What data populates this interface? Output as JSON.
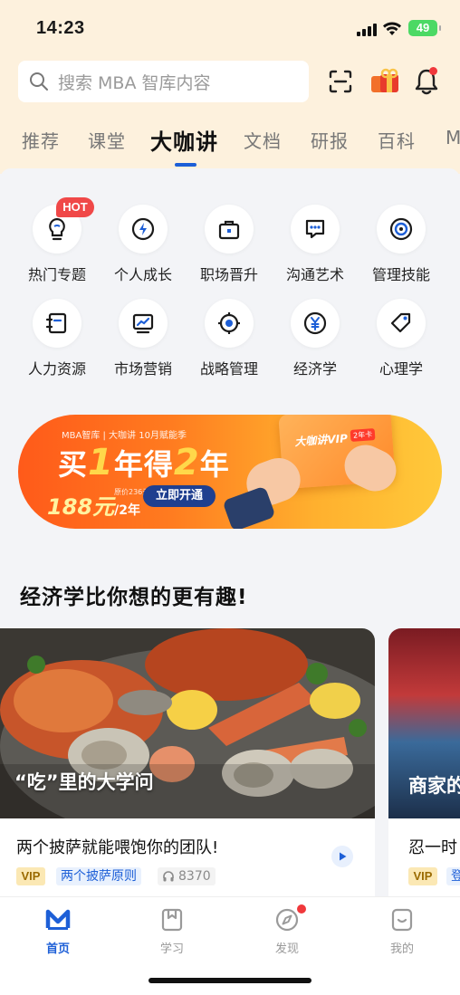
{
  "status_bar": {
    "time": "14:23",
    "battery": "49"
  },
  "search": {
    "placeholder": "搜索 MBA 智库内容"
  },
  "tabs": [
    {
      "label": "推荐"
    },
    {
      "label": "课堂"
    },
    {
      "label": "大咖讲"
    },
    {
      "label": "文档"
    },
    {
      "label": "研报"
    },
    {
      "label": "百科"
    },
    {
      "label": "M"
    }
  ],
  "active_tab": "大咖讲",
  "categories": [
    {
      "label": "热门专题",
      "icon": "bulb-icon",
      "badge": "HOT"
    },
    {
      "label": "个人成长",
      "icon": "lightning-icon"
    },
    {
      "label": "职场晋升",
      "icon": "briefcase-icon"
    },
    {
      "label": "沟通艺术",
      "icon": "chat-icon"
    },
    {
      "label": "管理技能",
      "icon": "target-ring-icon"
    },
    {
      "label": "人力资源",
      "icon": "notebook-icon"
    },
    {
      "label": "市场营销",
      "icon": "trend-chart-icon"
    },
    {
      "label": "战略管理",
      "icon": "crosshair-icon"
    },
    {
      "label": "经济学",
      "icon": "yen-coin-icon"
    },
    {
      "label": "心理学",
      "icon": "tag-icon"
    }
  ],
  "banner": {
    "mini_text": "MBA智库 | 大咖讲  10月赋能季",
    "headline_pre": "买",
    "headline_num1": "1",
    "headline_mid": "年得",
    "headline_num2": "2",
    "headline_post": "年",
    "original_price": "原价236元/2年",
    "price": "188元",
    "price_unit": "/2年",
    "cta": "立即开通",
    "card_title": "大咖讲VIP",
    "card_badge": "2年卡"
  },
  "section": {
    "title": "经济学比你想的更有趣!",
    "cards": [
      {
        "image_caption": "“吃”里的大学问",
        "title": "两个披萨就能喂饱你的团队!",
        "vip": "VIP",
        "topic": "两个披萨原则",
        "plays": "8370"
      },
      {
        "image_caption": "商家的",
        "title": "忍一时",
        "vip": "VIP",
        "topic": "登"
      }
    ]
  },
  "bottom_nav": [
    {
      "label": "首页",
      "icon": "mba-logo-icon",
      "active": true
    },
    {
      "label": "学习",
      "icon": "bookmark-icon"
    },
    {
      "label": "发现",
      "icon": "compass-icon",
      "dot": true
    },
    {
      "label": "我的",
      "icon": "profile-face-icon"
    }
  ],
  "colors": {
    "accent": "#1d5fd7",
    "header_bg": "#fdf1dd",
    "hot": "#f04848"
  }
}
